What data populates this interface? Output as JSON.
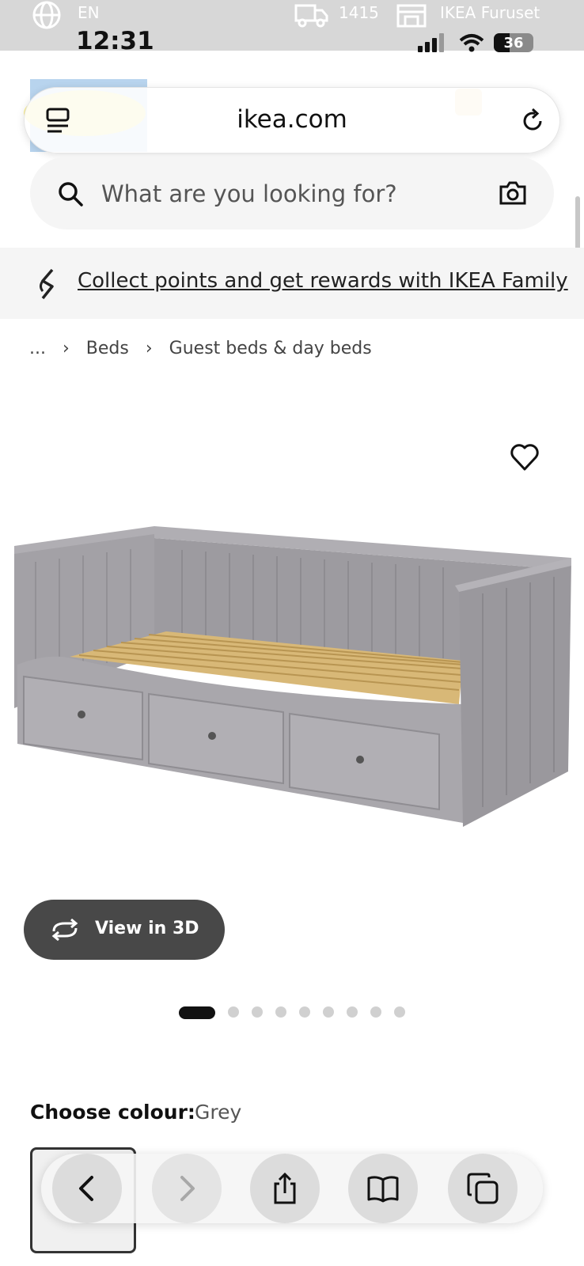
{
  "status": {
    "language": "EN",
    "delivery_code": "1415",
    "store": "IKEA Furuset",
    "time": "12:31",
    "battery": "36"
  },
  "browser": {
    "url": "ikea.com"
  },
  "search": {
    "placeholder": "What are you looking for?"
  },
  "banner": {
    "text": "Collect points and get rewards with IKEA Family"
  },
  "breadcrumb": {
    "ellipsis": "...",
    "items": [
      "Beds",
      "Guest beds & day beds"
    ]
  },
  "product": {
    "view_3d_label": "View in 3D",
    "image_count": 9,
    "active_image": 1
  },
  "colour": {
    "label": "Choose colour:",
    "value": "Grey"
  },
  "icons": [
    "globe-icon",
    "truck-icon",
    "store-icon",
    "signal-icon",
    "wifi-icon",
    "battery-icon",
    "tabs-menu-icon",
    "reload-icon",
    "search-icon",
    "camera-icon",
    "ikea-family-icon",
    "chevron-right-icon",
    "heart-icon",
    "rotate-3d-icon",
    "back-icon",
    "forward-icon",
    "share-icon",
    "bookmarks-icon",
    "tabs-icon"
  ]
}
